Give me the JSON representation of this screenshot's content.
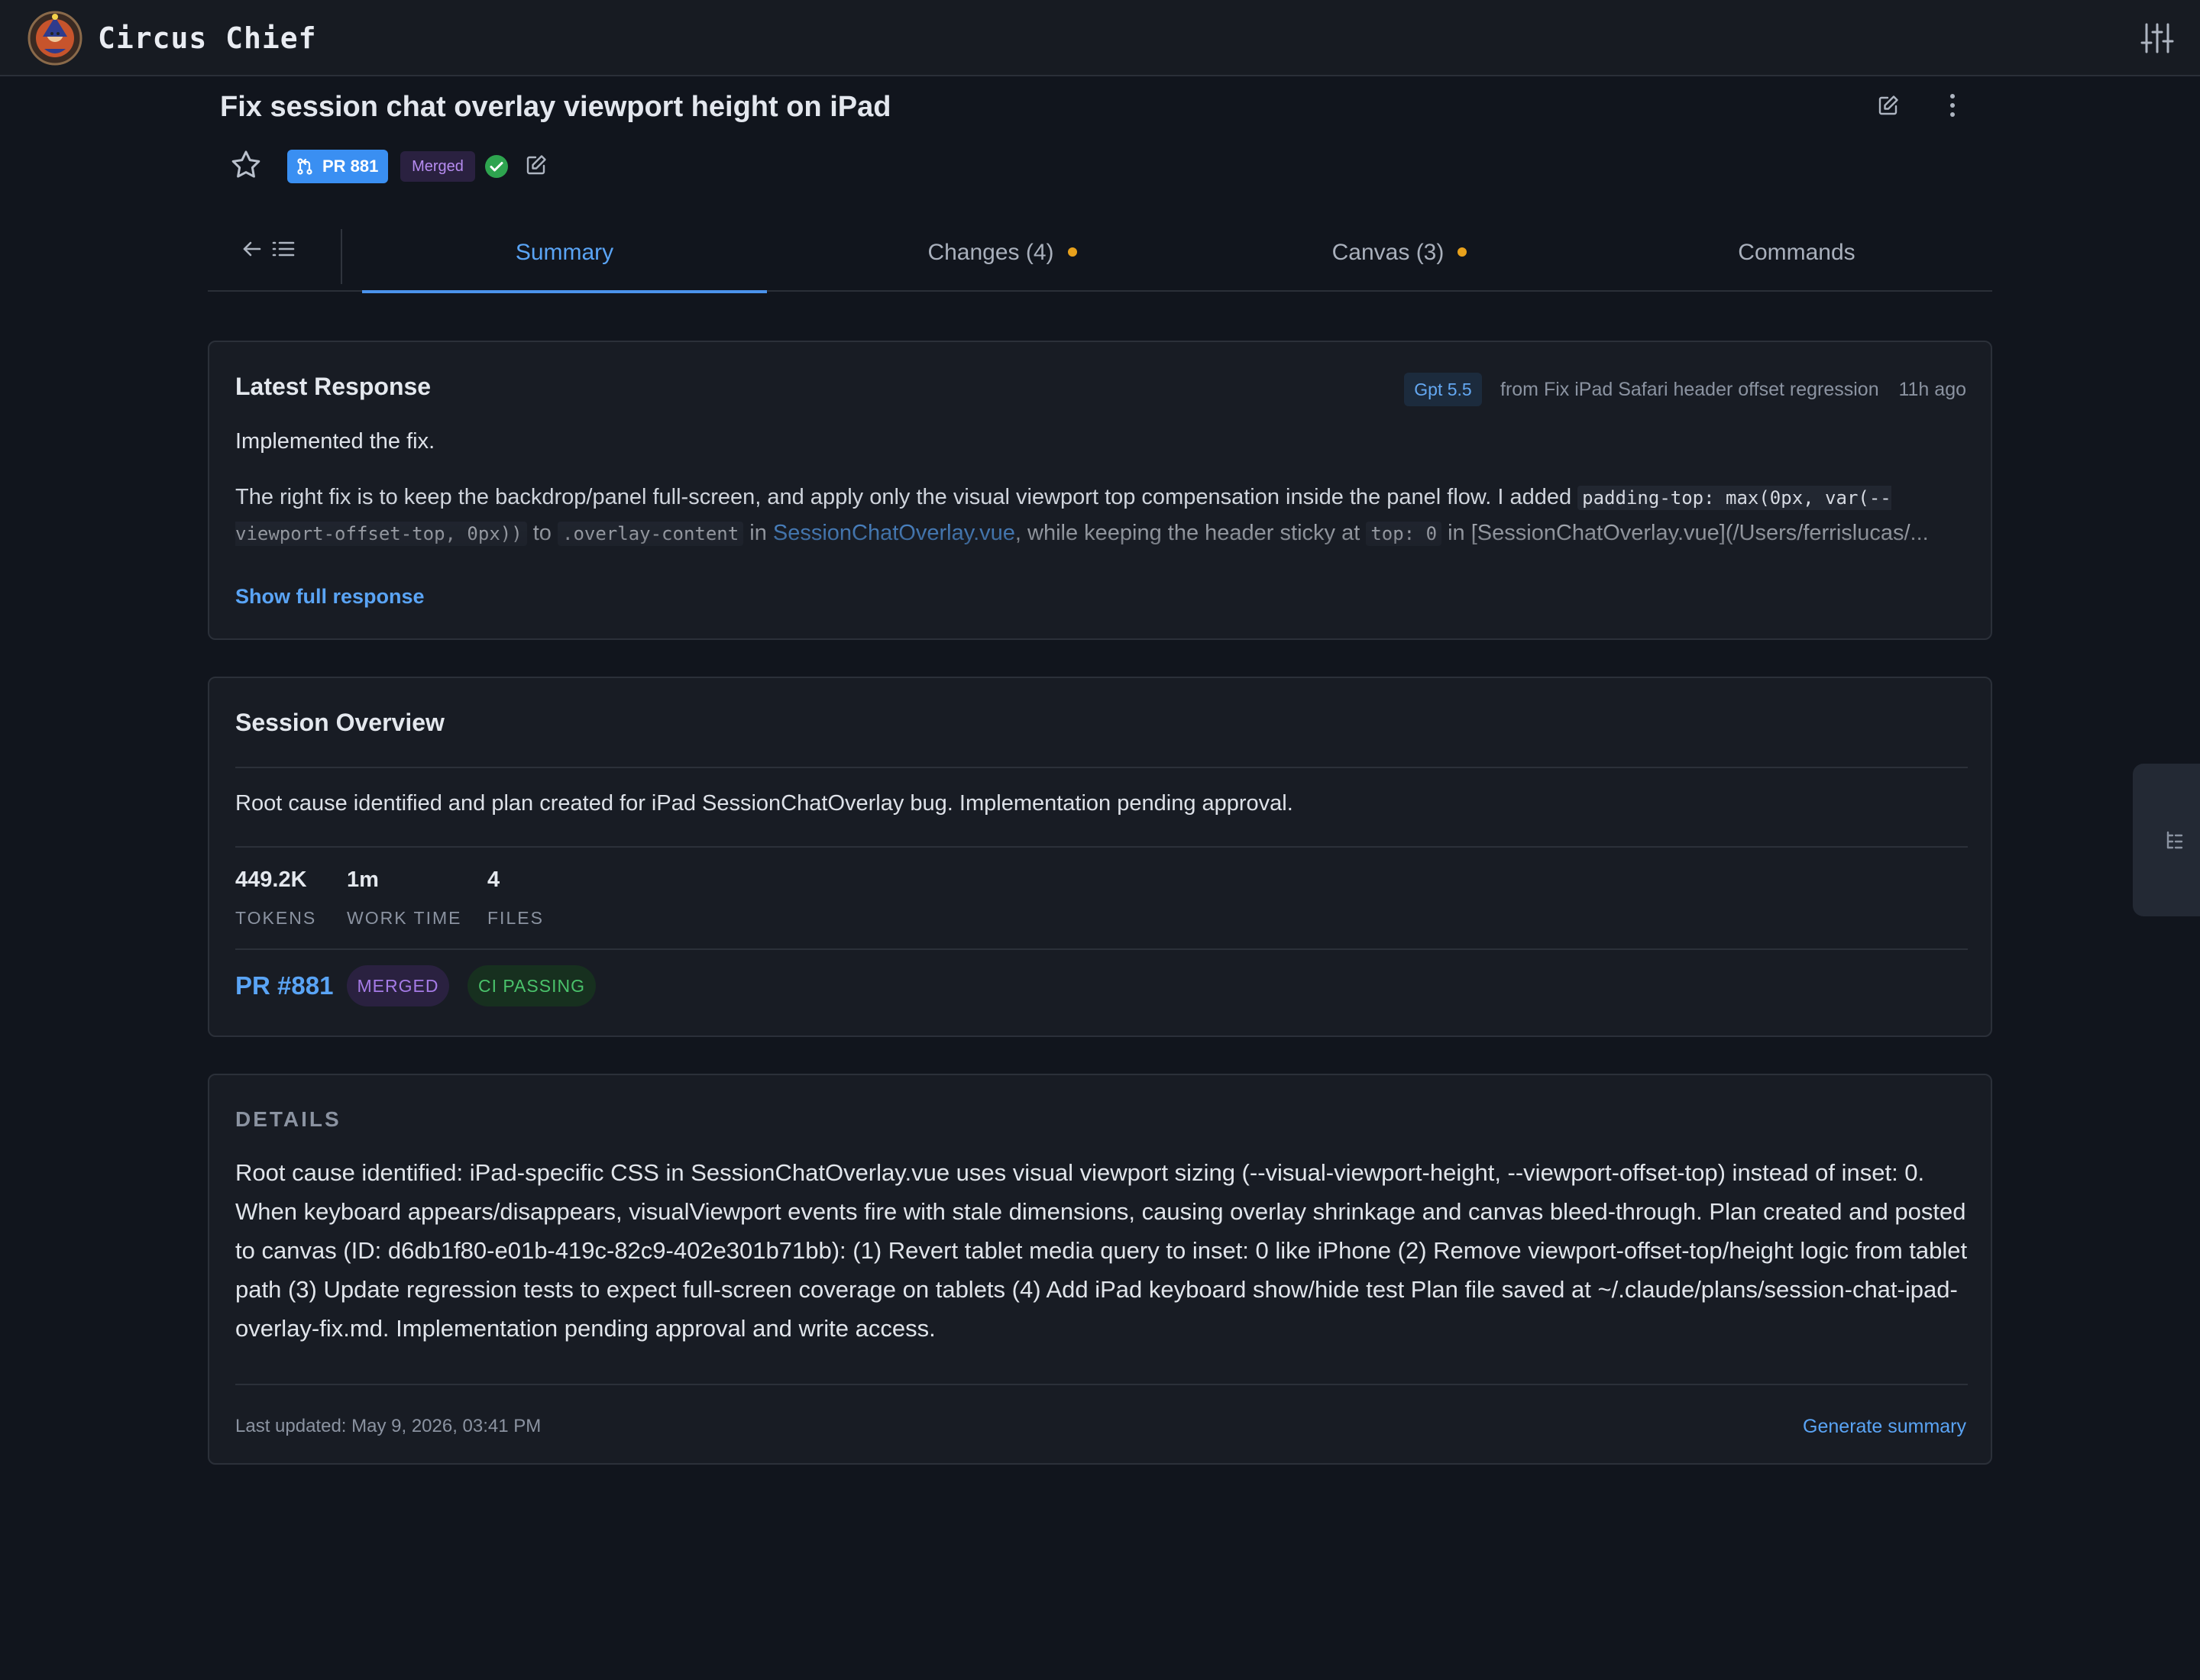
{
  "app": {
    "name": "Circus Chief",
    "logo_icon": "circus-logo-icon",
    "settings_icon": "sliders-icon"
  },
  "header": {
    "title": "Fix session chat overlay viewport height on iPad",
    "edit_icon": "edit-icon",
    "more_icon": "more-vertical-icon"
  },
  "meta": {
    "pr_label": "PR 881",
    "merged_label": "Merged",
    "status_icon": "check-circle-icon",
    "accent": "#3a8ff2"
  },
  "tabs": {
    "items": [
      {
        "label": "Summary",
        "active": true
      },
      {
        "label": "Changes (4)",
        "dot": true
      },
      {
        "label": "Canvas (3)",
        "dot": true
      },
      {
        "label": "Commands"
      }
    ]
  },
  "latest_response": {
    "title": "Latest Response",
    "model": "Gpt 5.5",
    "from": "from Fix iPad Safari header offset regression",
    "ago": "11h ago",
    "first_line": "Implemented the fix.",
    "body_parts": {
      "p1": "The right fix is to keep the backdrop/panel full-screen, and apply only the visual viewport top compensation inside the panel flow. I added ",
      "code1": "padding-top: max(0px, var(--viewport-offset-top, 0px))",
      "p2": " to ",
      "code2": ".overlay-content",
      "p3": " in ",
      "link1": "SessionChatOverlay.vue",
      "p4": ", while keeping the header sticky at ",
      "code3": "top: 0",
      "p5": " in [SessionChatOverlay.vue](/Users/ferrislucas/..."
    },
    "show_full": "Show full response"
  },
  "overview": {
    "title": "Session Overview",
    "summary": "Root cause identified and plan created for iPad SessionChatOverlay bug. Implementation pending approval.",
    "stats": [
      {
        "value": "449.2K",
        "label": "TOKENS"
      },
      {
        "value": "1m",
        "label": "WORK TIME"
      },
      {
        "value": "4",
        "label": "FILES"
      }
    ],
    "pr_link": "PR #881",
    "merged_pill": "MERGED",
    "ci_pill": "CI PASSING"
  },
  "details": {
    "heading": "DETAILS",
    "body": "Root cause identified: iPad-specific CSS in SessionChatOverlay.vue uses visual viewport sizing (--visual-viewport-height, --viewport-offset-top) instead of inset: 0. When keyboard appears/disappears, visualViewport events fire with stale dimensions, causing overlay shrinkage and canvas bleed-through. Plan created and posted to canvas (ID: d6db1f80-e01b-419c-82c9-402e301b71bb): (1) Revert tablet media query to inset: 0 like iPhone (2) Remove viewport-offset-top/height logic from tablet path (3) Update regression tests to expect full-screen coverage on tablets (4) Add iPad keyboard show/hide test Plan file saved at ~/.claude/plans/session-chat-ipad-overlay-fix.md. Implementation pending approval and write access.",
    "last_updated": "Last updated: May 9, 2026, 03:41 PM",
    "generate_summary": "Generate summary"
  },
  "side_handle_icon": "panel-toggle-icon"
}
